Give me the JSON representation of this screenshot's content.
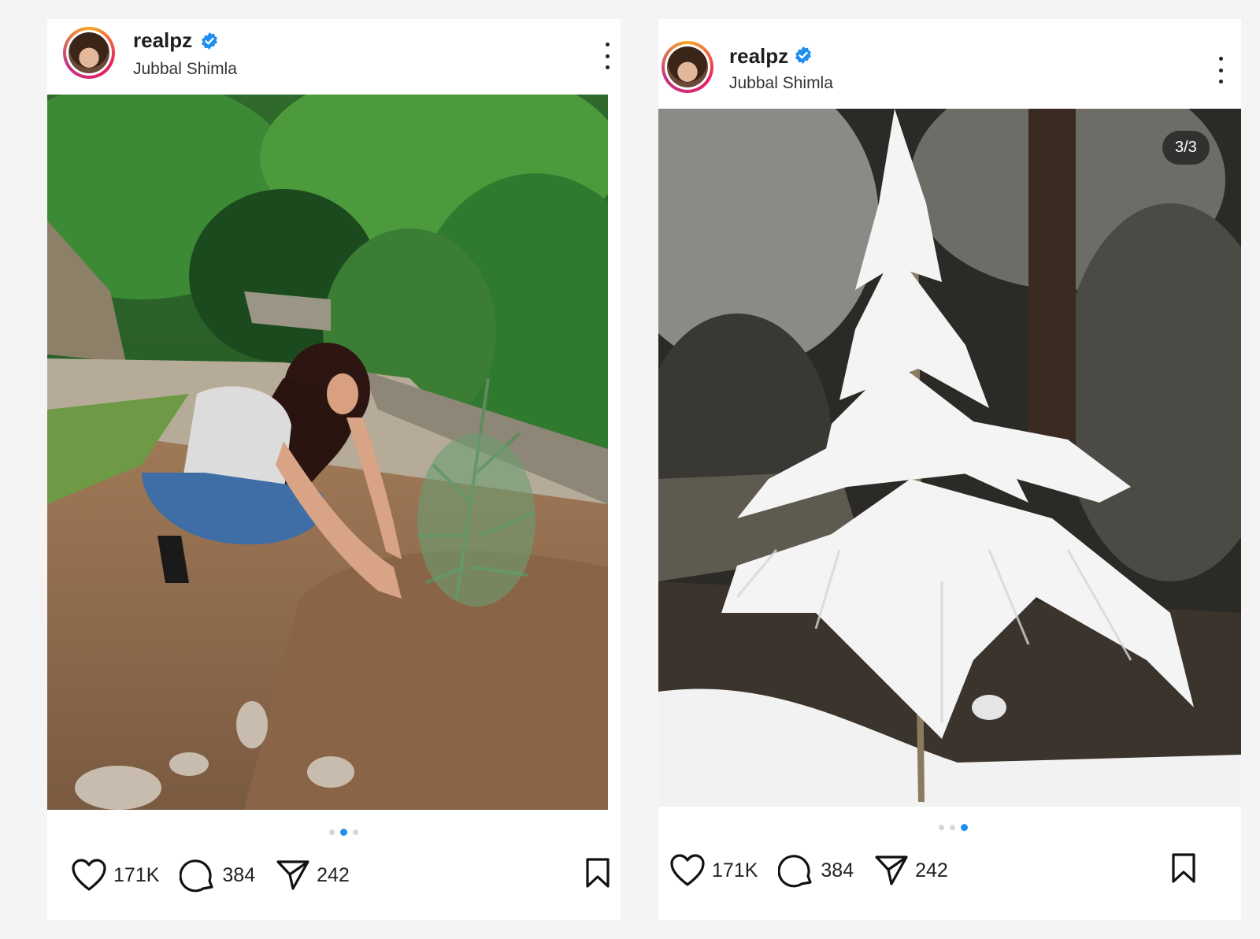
{
  "posts": [
    {
      "username": "realpz",
      "location": "Jubbal Shimla",
      "likes": "171K",
      "comments": "384",
      "shares": "242",
      "carousel_total": 3,
      "carousel_active_index": 2,
      "photo_subject": "woman planting a sapling on a hillside path"
    },
    {
      "username": "realpz",
      "location": "Jubbal Shimla",
      "likes": "171K",
      "comments": "384",
      "shares": "242",
      "image_counter": "3/3",
      "carousel_total": 3,
      "carousel_active_index": 3,
      "photo_subject": "snow-covered young deodar tree"
    }
  ],
  "icons": [
    "verified-badge-icon",
    "more-options-icon",
    "heart-icon",
    "comment-icon",
    "share-icon",
    "bookmark-icon"
  ],
  "colors": {
    "verified_blue": "#1e8ff0",
    "active_dot": "#1e8ff0",
    "inactive_dot": "#d6d6d6"
  }
}
